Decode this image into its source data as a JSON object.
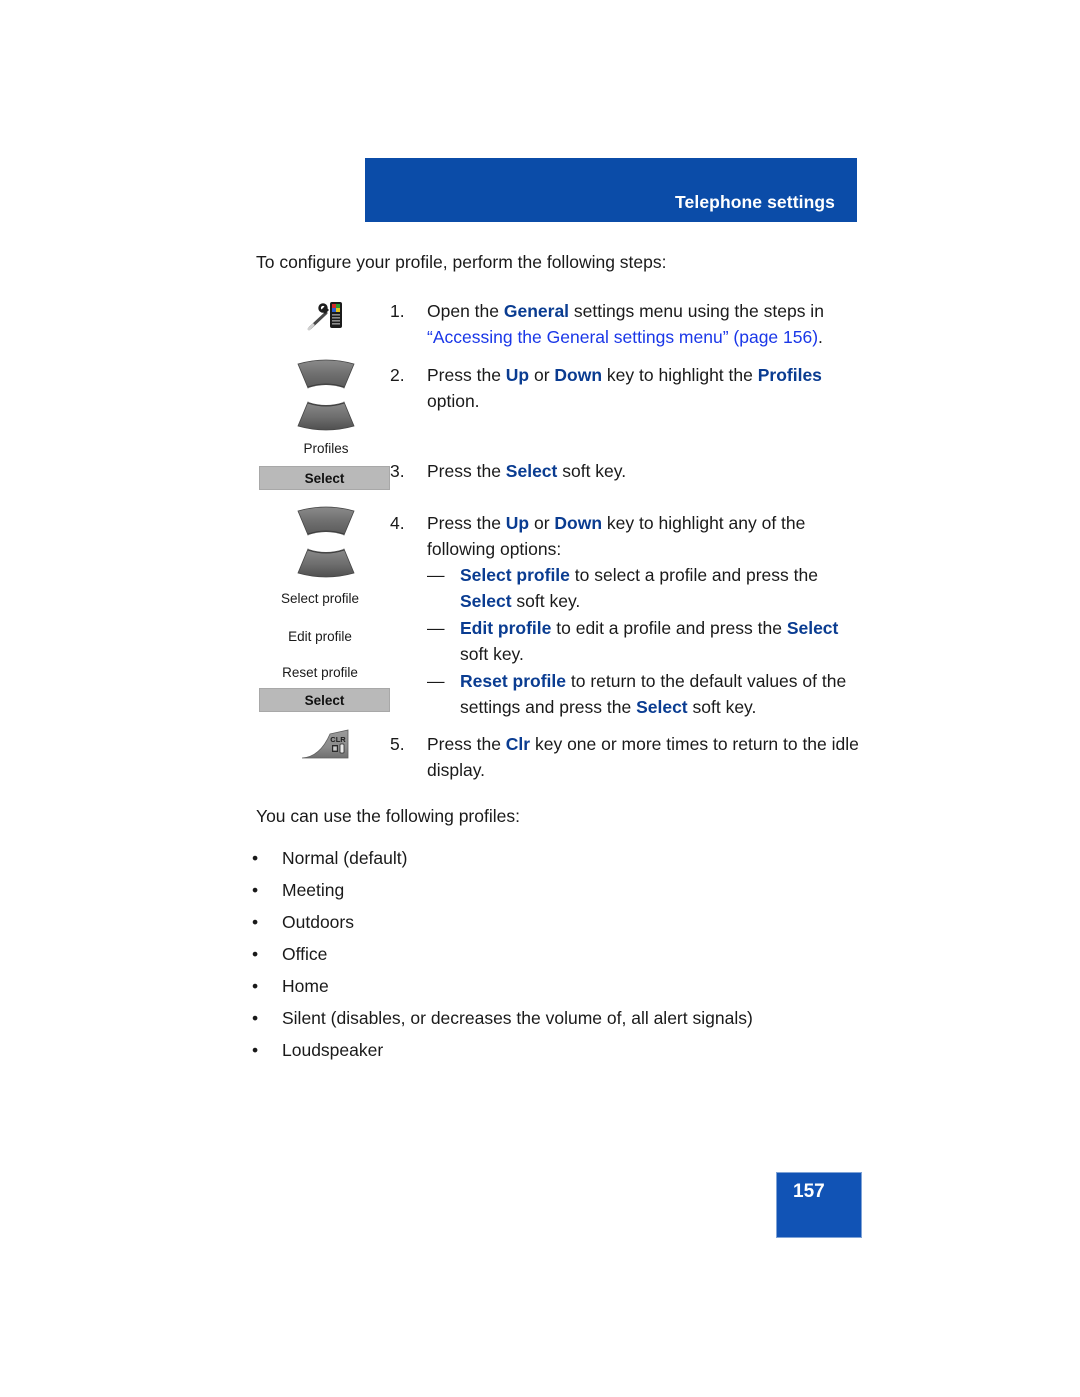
{
  "header": {
    "title": "Telephone settings",
    "banner_color": "#0B4CA8"
  },
  "intro": {
    "text": "To configure your profile, perform the following steps:"
  },
  "steps": [
    {
      "number": "1.",
      "parts": [
        {
          "t": "Open the ",
          "s": "plain"
        },
        {
          "t": "General",
          "s": "keyword"
        },
        {
          "t": " settings menu using the steps in ",
          "s": "plain"
        },
        {
          "t": "“Accessing the General settings menu” (page 156)",
          "s": "xref"
        },
        {
          "t": ".",
          "s": "plain"
        }
      ],
      "icon": "settings-wrench-phone-icon"
    },
    {
      "number": "2.",
      "parts": [
        {
          "t": "Press the ",
          "s": "plain"
        },
        {
          "t": "Up",
          "s": "keyword"
        },
        {
          "t": " or ",
          "s": "plain"
        },
        {
          "t": "Down",
          "s": "keyword"
        },
        {
          "t": " key to highlight the ",
          "s": "plain"
        },
        {
          "t": "Profiles",
          "s": "keyword"
        },
        {
          "t": " option.",
          "s": "plain"
        }
      ],
      "icon": "navigation-updown-key-icon",
      "icon_caption": "Profiles"
    },
    {
      "number": "3.",
      "parts": [
        {
          "t": "Press the ",
          "s": "plain"
        },
        {
          "t": "Select",
          "s": "keyword"
        },
        {
          "t": " soft key.",
          "s": "plain"
        }
      ],
      "icon": "select-soft-key",
      "softkey_label": "Select"
    },
    {
      "number": "4.",
      "parts": [
        {
          "t": "Press the ",
          "s": "plain"
        },
        {
          "t": "Up",
          "s": "keyword"
        },
        {
          "t": " or ",
          "s": "plain"
        },
        {
          "t": "Down",
          "s": "keyword"
        },
        {
          "t": " key to highlight any of the following options:",
          "s": "plain"
        }
      ],
      "icon": "navigation-updown-key-icon",
      "icon_caption": "Select profile"
    },
    {
      "number": "5.",
      "parts": [
        {
          "t": "Press the ",
          "s": "plain"
        },
        {
          "t": "Clr",
          "s": "keyword"
        },
        {
          "t": " key one or more times to return to the idle display.",
          "s": "plain"
        }
      ],
      "icon": "clr-key-icon"
    }
  ],
  "sub_options": [
    {
      "dash": "—",
      "parts": [
        {
          "t": "Select profile",
          "s": "keyword"
        },
        {
          "t": " to select a profile and press the ",
          "s": "plain"
        },
        {
          "t": "Select",
          "s": "keyword"
        },
        {
          "t": " soft key.",
          "s": "plain"
        }
      ]
    },
    {
      "dash": "—",
      "parts": [
        {
          "t": "Edit profile",
          "s": "keyword"
        },
        {
          "t": " to edit a profile and press the ",
          "s": "plain"
        },
        {
          "t": "Select",
          "s": "keyword"
        },
        {
          "t": " soft key.",
          "s": "plain"
        }
      ]
    },
    {
      "dash": "—",
      "parts": [
        {
          "t": "Reset profile",
          "s": "keyword"
        },
        {
          "t": " to return to the default values of the settings and press the ",
          "s": "plain"
        },
        {
          "t": "Select",
          "s": "keyword"
        },
        {
          "t": " soft key.",
          "s": "plain"
        }
      ]
    }
  ],
  "margin_captions": {
    "profiles": "Profiles",
    "select_profile": "Select profile",
    "edit_profile": "Edit profile",
    "reset_profile": "Reset profile"
  },
  "soft_keys": {
    "first": "Select",
    "second": "Select"
  },
  "profiles_intro": "You can use the following profiles:",
  "profiles": [
    {
      "bullet": "•",
      "label": "Normal (default)"
    },
    {
      "bullet": "•",
      "label": "Meeting"
    },
    {
      "bullet": "•",
      "label": "Outdoors"
    },
    {
      "bullet": "•",
      "label": "Office"
    },
    {
      "bullet": "•",
      "label": "Home"
    },
    {
      "bullet": "•",
      "label": "Silent (disables, or decreases the volume of, all alert signals)"
    },
    {
      "bullet": "•",
      "label": "Loudspeaker"
    }
  ],
  "page_number": "157",
  "colors": {
    "banner_blue": "#0B4CA8",
    "keyword_blue": "#0A3C91",
    "xref_blue": "#1A37E8",
    "page_box_blue": "#1153B5",
    "softkey_gray": "#b9b9b9"
  }
}
